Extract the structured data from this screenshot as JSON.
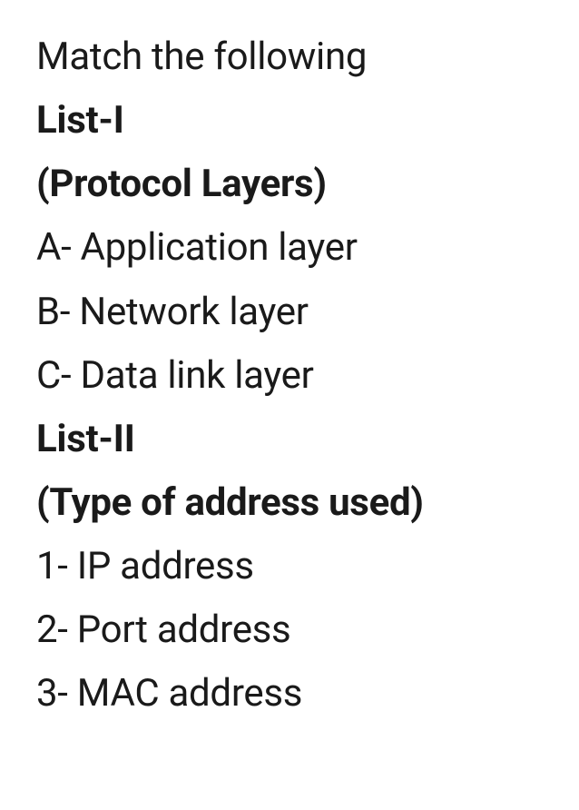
{
  "question": {
    "prompt": "Match the following",
    "list1_title": "List-I",
    "list1_subtitle": "(Protocol Layers)",
    "list1_items": [
      "A- Application layer",
      "B- Network layer",
      "C- Data link layer"
    ],
    "list2_title": "List-II",
    "list2_subtitle": "(Type of address used)",
    "list2_items": [
      "1- IP address",
      "2- Port address",
      "3- MAC address"
    ]
  }
}
